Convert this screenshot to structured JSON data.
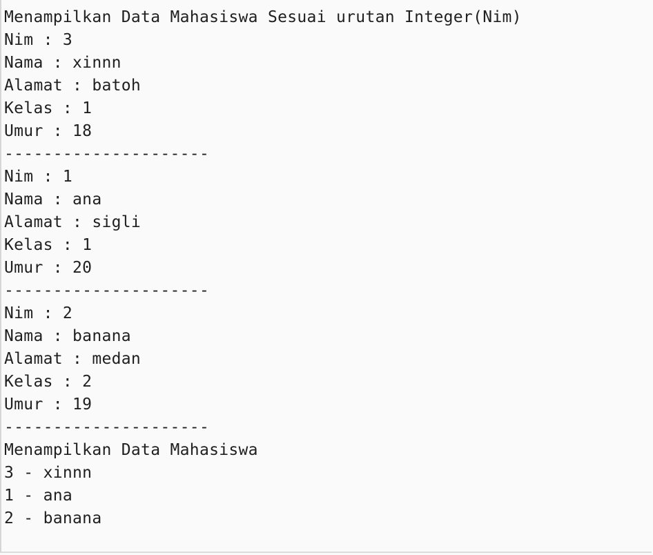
{
  "console": {
    "lines": [
      "Menampilkan Data Mahasiswa Sesuai urutan Integer(Nim)",
      "Nim : 3",
      "Nama : xinnn",
      "Alamat : batoh",
      "Kelas : 1",
      "Umur : 18",
      "---------------------",
      "Nim : 1",
      "Nama : ana",
      "Alamat : sigli",
      "Kelas : 1",
      "Umur : 20",
      "---------------------",
      "Nim : 2",
      "Nama : banana",
      "Alamat : medan",
      "Kelas : 2",
      "Umur : 19",
      "---------------------",
      "Menampilkan Data Mahasiswa",
      "3 - xinnn",
      "1 - ana",
      "2 - banana"
    ]
  }
}
